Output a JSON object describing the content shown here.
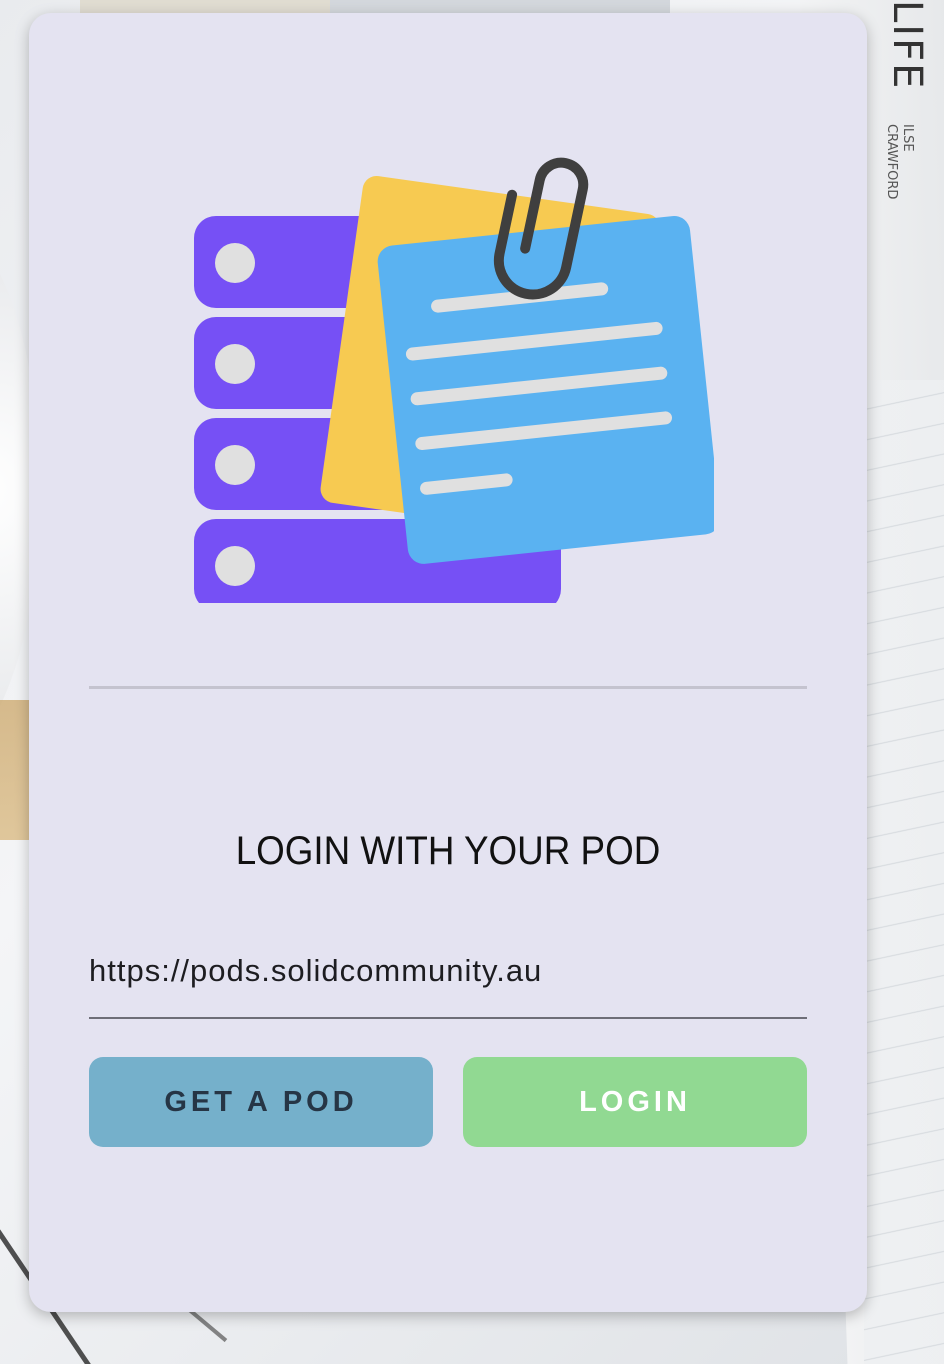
{
  "background": {
    "book_title": "LIFE",
    "book_author": "ILSE\nCRAWFORD"
  },
  "login": {
    "title": "LOGIN WITH YOUR POD",
    "server_url": "https://pods.solidcommunity.au",
    "get_pod_label": "GET A POD",
    "login_label": "LOGIN"
  },
  "colors": {
    "card_bg": "#e4e3f1",
    "server_stack": "#7650f5",
    "note_yellow": "#f7ca51",
    "note_blue": "#5ab2f1",
    "get_pod_button": "#75b0cb",
    "login_button": "#91d992"
  },
  "icons": {
    "logo": "server-with-notes-and-paperclip"
  }
}
